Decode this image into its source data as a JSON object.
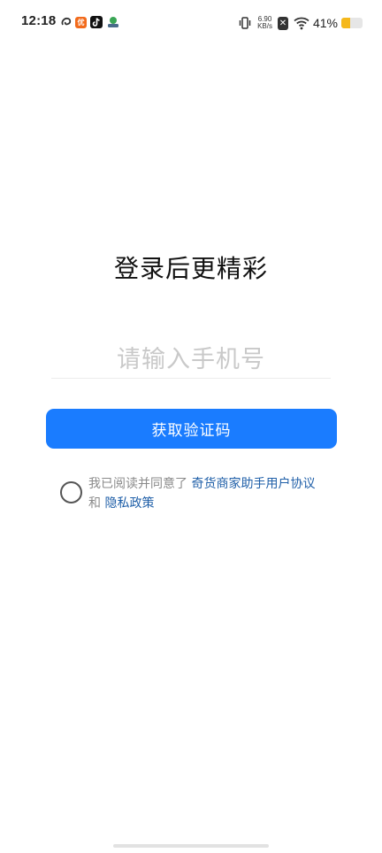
{
  "status_bar": {
    "time": "12:18",
    "notif_badge": "优",
    "net_speed_value": "6.90",
    "net_speed_unit": "KB/s",
    "sim_label": "✕",
    "battery_text": "41%",
    "battery_level": 0.41,
    "battery_color": "#f5b81c"
  },
  "login": {
    "title": "登录后更精彩",
    "phone_placeholder": "请输入手机号",
    "phone_value": "",
    "get_code_button": "获取验证码"
  },
  "agreement": {
    "prefix": "我已阅读并同意了",
    "terms_link": "奇货商家助手用户协议",
    "conjunction": "和",
    "privacy_link": "隐私政策",
    "checked": false
  },
  "colors": {
    "primary": "#1a7cff",
    "link": "#1f5fa8"
  }
}
